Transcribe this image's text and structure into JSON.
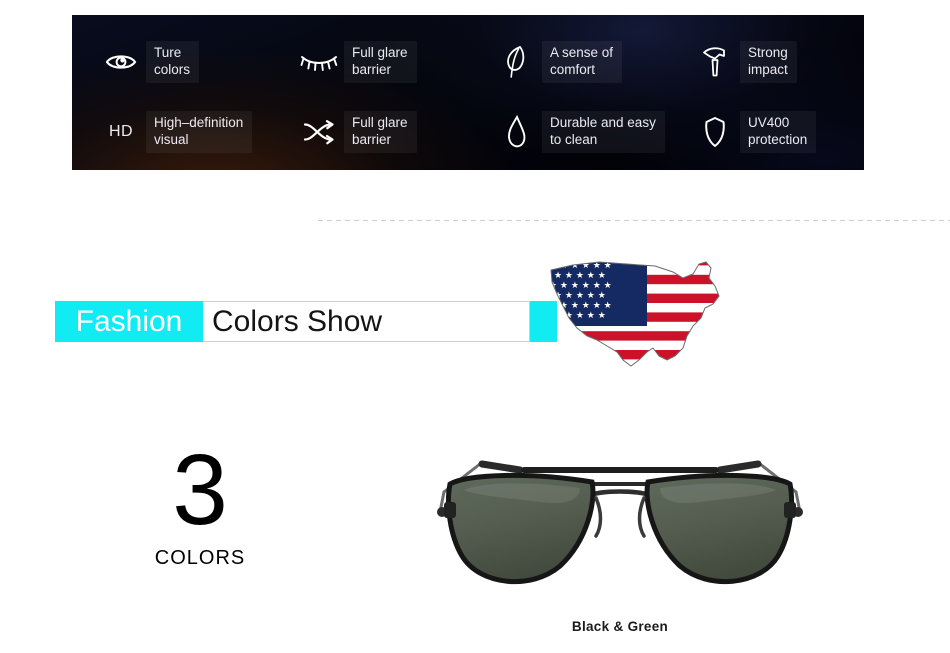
{
  "banner": {
    "accent_color": "#15f0f5",
    "background_color": "#05070f",
    "features": [
      {
        "icon": "eye-icon",
        "label": "Ture\ncolors"
      },
      {
        "icon": "eyelash-icon",
        "label": "Full glare\nbarrier"
      },
      {
        "icon": "feather-icon",
        "label": "A sense of\ncomfort"
      },
      {
        "icon": "hammer-icon",
        "label": "Strong\nimpact"
      },
      {
        "icon": "hd-text-icon",
        "label": "High–definition\nvisual",
        "icon_text": "HD"
      },
      {
        "icon": "shuffle-icon",
        "label": "Full glare\nbarrier"
      },
      {
        "icon": "waterdrop-icon",
        "label": "Durable and easy\nto clean"
      },
      {
        "icon": "shield-icon",
        "label": "UV400\nprotection"
      }
    ]
  },
  "title": {
    "highlight_word": "Fashion",
    "rest_words": "Colors Show",
    "highlight_bg": "#11ecf4",
    "highlight_text_color": "#ffffff",
    "rest_text_color": "#141414",
    "flag_alt": "usa-flag-map"
  },
  "colors_section": {
    "count": "3",
    "count_label": "COLORS"
  },
  "product": {
    "name": "aviator-sunglasses",
    "caption": "Black & Green",
    "frame_color": "#1b1b1b",
    "lens_color": "#535c4e"
  }
}
